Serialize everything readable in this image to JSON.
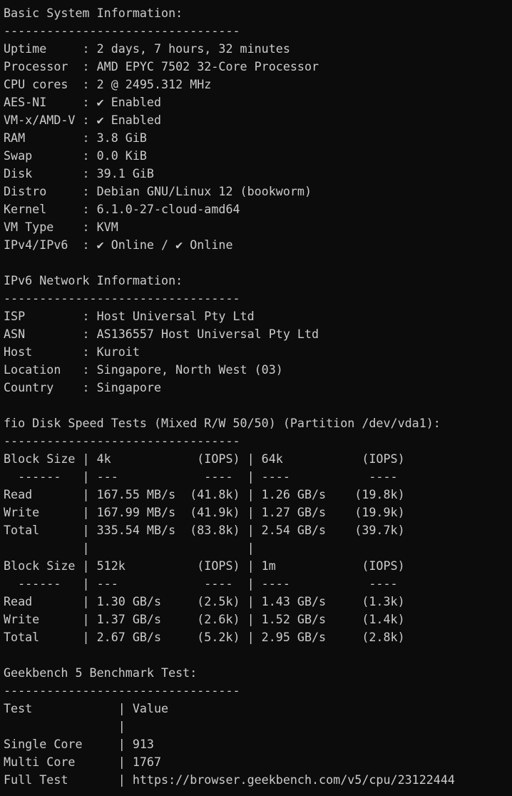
{
  "window": {
    "type": "terminal",
    "background_color": "#0c0c0c",
    "text_color": "#cccccc"
  },
  "lines": [
    "Basic System Information:",
    "---------------------------------",
    "Uptime     : 2 days, 7 hours, 32 minutes",
    "Processor  : AMD EPYC 7502 32-Core Processor",
    "CPU cores  : 2 @ 2495.312 MHz",
    "AES-NI     : ✔ Enabled",
    "VM-x/AMD-V : ✔ Enabled",
    "RAM        : 3.8 GiB",
    "Swap       : 0.0 KiB",
    "Disk       : 39.1 GiB",
    "Distro     : Debian GNU/Linux 12 (bookworm)",
    "Kernel     : 6.1.0-27-cloud-amd64",
    "VM Type    : KVM",
    "IPv4/IPv6  : ✔ Online / ✔ Online",
    "",
    "IPv6 Network Information:",
    "---------------------------------",
    "ISP        : Host Universal Pty Ltd",
    "ASN        : AS136557 Host Universal Pty Ltd",
    "Host       : Kuroit",
    "Location   : Singapore, North West (03)",
    "Country    : Singapore",
    "",
    "fio Disk Speed Tests (Mixed R/W 50/50) (Partition /dev/vda1):",
    "---------------------------------",
    "Block Size | 4k            (IOPS) | 64k           (IOPS)",
    "  ------   | ---            ----  | ----           ---- ",
    "Read       | 167.55 MB/s  (41.8k) | 1.26 GB/s    (19.8k)",
    "Write      | 167.99 MB/s  (41.9k) | 1.27 GB/s    (19.9k)",
    "Total      | 335.54 MB/s  (83.8k) | 2.54 GB/s    (39.7k)",
    "           |                      |                     ",
    "Block Size | 512k          (IOPS) | 1m            (IOPS)",
    "  ------   | ---            ----  | ----           ---- ",
    "Read       | 1.30 GB/s     (2.5k) | 1.43 GB/s     (1.3k)",
    "Write      | 1.37 GB/s     (2.6k) | 1.52 GB/s     (1.4k)",
    "Total      | 2.67 GB/s     (5.2k) | 2.95 GB/s     (2.8k)",
    "",
    "Geekbench 5 Benchmark Test:",
    "---------------------------------",
    "Test            | Value",
    "                |",
    "Single Core     | 913",
    "Multi Core      | 1767",
    "Full Test       | https://browser.geekbench.com/v5/cpu/23122444"
  ]
}
